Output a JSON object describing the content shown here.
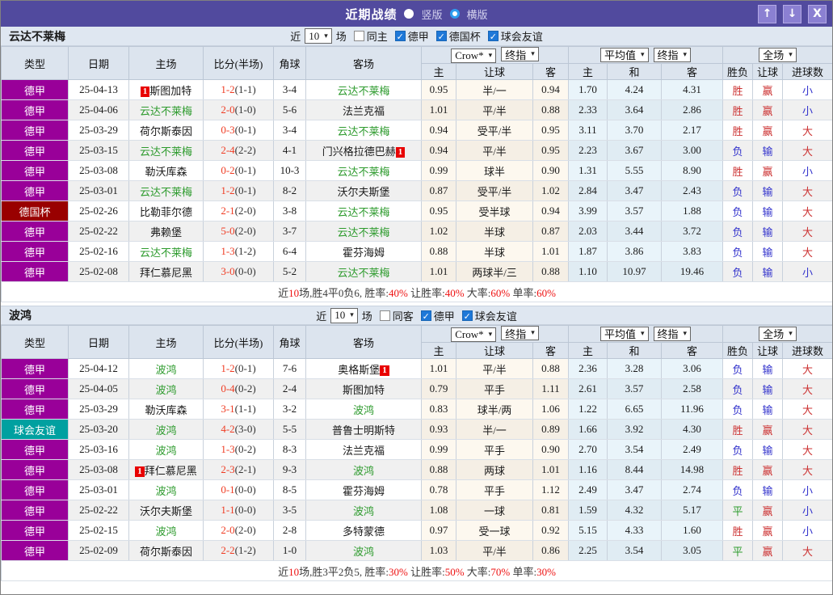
{
  "titlebar": {
    "title": "近期战绩",
    "radio_vertical": "竖版",
    "radio_horizontal": "横版",
    "selected_layout": "横版",
    "button_up": "↑",
    "button_down": "↓",
    "button_close": "X"
  },
  "badge": {
    "text": "1"
  },
  "colors": {
    "titlebar_bg": "#514a9e",
    "type_bg": {
      "德甲": "#990099",
      "德国杯": "#990000",
      "球会友谊": "#00a0a0"
    },
    "focus_team_green": "#2e9b2e",
    "score_red": "#f03c23",
    "result_red": "#cc3333",
    "result_blue": "#3333cc",
    "result_green": "#2e9b2e",
    "summary_red": "#ee1111"
  },
  "result_class_map": {
    "胜": "red",
    "负": "blue",
    "平": "green",
    "赢": "red",
    "输": "blue",
    "大": "red",
    "小": "blue"
  },
  "table": {
    "main_headers": [
      "类型",
      "日期",
      "主场",
      "比分(半场)",
      "角球",
      "客场"
    ],
    "sub_headers": [
      "主",
      "让球",
      "客",
      "主",
      "和",
      "客",
      "胜负",
      "让球",
      "进球数"
    ],
    "selects": {
      "company": "Crow*",
      "company_mode": "终指",
      "avg": "平均值",
      "avg_mode": "终指",
      "scope": "全场"
    }
  },
  "sections": [
    {
      "team": "云达不莱梅",
      "filter": {
        "near_label": "近",
        "count": "10",
        "games_label": "场",
        "same": {
          "label": "同主",
          "checked": false
        },
        "comps": [
          {
            "label": "德甲",
            "checked": true
          },
          {
            "label": "德国杯",
            "checked": true
          },
          {
            "label": "球会友谊",
            "checked": true
          }
        ]
      },
      "rows": [
        {
          "type": "德甲",
          "date": "25-04-13",
          "home": "斯图加特",
          "home_focus": false,
          "home_badge": "before",
          "score": "1-2",
          "half": "(1-1)",
          "corner": "3-4",
          "away": "云达不莱梅",
          "away_focus": true,
          "away_badge": null,
          "odds": [
            "0.95",
            "半/一",
            "0.94"
          ],
          "avg": [
            "1.70",
            "4.24",
            "4.31"
          ],
          "result": [
            "胜",
            "赢",
            "小"
          ]
        },
        {
          "type": "德甲",
          "date": "25-04-06",
          "home": "云达不莱梅",
          "home_focus": true,
          "home_badge": null,
          "score": "2-0",
          "half": "(1-0)",
          "corner": "5-6",
          "away": "法兰克福",
          "away_focus": false,
          "away_badge": null,
          "odds": [
            "1.01",
            "平/半",
            "0.88"
          ],
          "avg": [
            "2.33",
            "3.64",
            "2.86"
          ],
          "result": [
            "胜",
            "赢",
            "小"
          ]
        },
        {
          "type": "德甲",
          "date": "25-03-29",
          "home": "荷尔斯泰因",
          "home_focus": false,
          "home_badge": null,
          "score": "0-3",
          "half": "(0-1)",
          "corner": "3-4",
          "away": "云达不莱梅",
          "away_focus": true,
          "away_badge": null,
          "odds": [
            "0.94",
            "受平/半",
            "0.95"
          ],
          "avg": [
            "3.11",
            "3.70",
            "2.17"
          ],
          "result": [
            "胜",
            "赢",
            "大"
          ]
        },
        {
          "type": "德甲",
          "date": "25-03-15",
          "home": "云达不莱梅",
          "home_focus": true,
          "home_badge": null,
          "score": "2-4",
          "half": "(2-2)",
          "corner": "4-1",
          "away": "门兴格拉德巴赫",
          "away_focus": false,
          "away_badge": "after",
          "odds": [
            "0.94",
            "平/半",
            "0.95"
          ],
          "avg": [
            "2.23",
            "3.67",
            "3.00"
          ],
          "result": [
            "负",
            "输",
            "大"
          ]
        },
        {
          "type": "德甲",
          "date": "25-03-08",
          "home": "勒沃库森",
          "home_focus": false,
          "home_badge": null,
          "score": "0-2",
          "half": "(0-1)",
          "corner": "10-3",
          "away": "云达不莱梅",
          "away_focus": true,
          "away_badge": null,
          "odds": [
            "0.99",
            "球半",
            "0.90"
          ],
          "avg": [
            "1.31",
            "5.55",
            "8.90"
          ],
          "result": [
            "胜",
            "赢",
            "小"
          ]
        },
        {
          "type": "德甲",
          "date": "25-03-01",
          "home": "云达不莱梅",
          "home_focus": true,
          "home_badge": null,
          "score": "1-2",
          "half": "(0-1)",
          "corner": "8-2",
          "away": "沃尔夫斯堡",
          "away_focus": false,
          "away_badge": null,
          "odds": [
            "0.87",
            "受平/半",
            "1.02"
          ],
          "avg": [
            "2.84",
            "3.47",
            "2.43"
          ],
          "result": [
            "负",
            "输",
            "大"
          ]
        },
        {
          "type": "德国杯",
          "date": "25-02-26",
          "home": "比勒菲尔德",
          "home_focus": false,
          "home_badge": null,
          "score": "2-1",
          "half": "(2-0)",
          "corner": "3-8",
          "away": "云达不莱梅",
          "away_focus": true,
          "away_badge": null,
          "odds": [
            "0.95",
            "受半球",
            "0.94"
          ],
          "avg": [
            "3.99",
            "3.57",
            "1.88"
          ],
          "result": [
            "负",
            "输",
            "大"
          ]
        },
        {
          "type": "德甲",
          "date": "25-02-22",
          "home": "弗赖堡",
          "home_focus": false,
          "home_badge": null,
          "score": "5-0",
          "half": "(2-0)",
          "corner": "3-7",
          "away": "云达不莱梅",
          "away_focus": true,
          "away_badge": null,
          "odds": [
            "1.02",
            "半球",
            "0.87"
          ],
          "avg": [
            "2.03",
            "3.44",
            "3.72"
          ],
          "result": [
            "负",
            "输",
            "大"
          ]
        },
        {
          "type": "德甲",
          "date": "25-02-16",
          "home": "云达不莱梅",
          "home_focus": true,
          "home_badge": null,
          "score": "1-3",
          "half": "(1-2)",
          "corner": "6-4",
          "away": "霍芬海姆",
          "away_focus": false,
          "away_badge": null,
          "odds": [
            "0.88",
            "半球",
            "1.01"
          ],
          "avg": [
            "1.87",
            "3.86",
            "3.83"
          ],
          "result": [
            "负",
            "输",
            "大"
          ]
        },
        {
          "type": "德甲",
          "date": "25-02-08",
          "home": "拜仁慕尼黑",
          "home_focus": false,
          "home_badge": null,
          "score": "3-0",
          "half": "(0-0)",
          "corner": "5-2",
          "away": "云达不莱梅",
          "away_focus": true,
          "away_badge": null,
          "odds": [
            "1.01",
            "两球半/三",
            "0.88"
          ],
          "avg": [
            "1.10",
            "10.97",
            "19.46"
          ],
          "result": [
            "负",
            "输",
            "小"
          ]
        }
      ],
      "summary_segments": [
        {
          "t": "近"
        },
        {
          "t": "10",
          "red": true
        },
        {
          "t": "场,胜4平0负6, 胜率:"
        },
        {
          "t": "40%",
          "red": true
        },
        {
          "t": " 让胜率:"
        },
        {
          "t": "40%",
          "red": true
        },
        {
          "t": " 大率:"
        },
        {
          "t": "60%",
          "red": true
        },
        {
          "t": " 单率:"
        },
        {
          "t": "60%",
          "red": true
        }
      ]
    },
    {
      "team": "波鸿",
      "filter": {
        "near_label": "近",
        "count": "10",
        "games_label": "场",
        "same": {
          "label": "同客",
          "checked": false
        },
        "comps": [
          {
            "label": "德甲",
            "checked": true
          },
          {
            "label": "球会友谊",
            "checked": true
          }
        ]
      },
      "rows": [
        {
          "type": "德甲",
          "date": "25-04-12",
          "home": "波鸿",
          "home_focus": true,
          "home_badge": null,
          "score": "1-2",
          "half": "(0-1)",
          "corner": "7-6",
          "away": "奥格斯堡",
          "away_focus": false,
          "away_badge": "after",
          "odds": [
            "1.01",
            "平/半",
            "0.88"
          ],
          "avg": [
            "2.36",
            "3.28",
            "3.06"
          ],
          "result": [
            "负",
            "输",
            "大"
          ]
        },
        {
          "type": "德甲",
          "date": "25-04-05",
          "home": "波鸿",
          "home_focus": true,
          "home_badge": null,
          "score": "0-4",
          "half": "(0-2)",
          "corner": "2-4",
          "away": "斯图加特",
          "away_focus": false,
          "away_badge": null,
          "odds": [
            "0.79",
            "平手",
            "1.11"
          ],
          "avg": [
            "2.61",
            "3.57",
            "2.58"
          ],
          "result": [
            "负",
            "输",
            "大"
          ]
        },
        {
          "type": "德甲",
          "date": "25-03-29",
          "home": "勒沃库森",
          "home_focus": false,
          "home_badge": null,
          "score": "3-1",
          "half": "(1-1)",
          "corner": "3-2",
          "away": "波鸿",
          "away_focus": true,
          "away_badge": null,
          "odds": [
            "0.83",
            "球半/两",
            "1.06"
          ],
          "avg": [
            "1.22",
            "6.65",
            "11.96"
          ],
          "result": [
            "负",
            "输",
            "大"
          ]
        },
        {
          "type": "球会友谊",
          "date": "25-03-20",
          "home": "波鸿",
          "home_focus": true,
          "home_badge": null,
          "score": "4-2",
          "half": "(3-0)",
          "corner": "5-5",
          "away": "普鲁士明斯特",
          "away_focus": false,
          "away_badge": null,
          "odds": [
            "0.93",
            "半/一",
            "0.89"
          ],
          "avg": [
            "1.66",
            "3.92",
            "4.30"
          ],
          "result": [
            "胜",
            "赢",
            "大"
          ]
        },
        {
          "type": "德甲",
          "date": "25-03-16",
          "home": "波鸿",
          "home_focus": true,
          "home_badge": null,
          "score": "1-3",
          "half": "(0-2)",
          "corner": "8-3",
          "away": "法兰克福",
          "away_focus": false,
          "away_badge": null,
          "odds": [
            "0.99",
            "平手",
            "0.90"
          ],
          "avg": [
            "2.70",
            "3.54",
            "2.49"
          ],
          "result": [
            "负",
            "输",
            "大"
          ]
        },
        {
          "type": "德甲",
          "date": "25-03-08",
          "home": "拜仁慕尼黑",
          "home_focus": false,
          "home_badge": "before",
          "score": "2-3",
          "half": "(2-1)",
          "corner": "9-3",
          "away": "波鸿",
          "away_focus": true,
          "away_badge": null,
          "odds": [
            "0.88",
            "两球",
            "1.01"
          ],
          "avg": [
            "1.16",
            "8.44",
            "14.98"
          ],
          "result": [
            "胜",
            "赢",
            "大"
          ]
        },
        {
          "type": "德甲",
          "date": "25-03-01",
          "home": "波鸿",
          "home_focus": true,
          "home_badge": null,
          "score": "0-1",
          "half": "(0-0)",
          "corner": "8-5",
          "away": "霍芬海姆",
          "away_focus": false,
          "away_badge": null,
          "odds": [
            "0.78",
            "平手",
            "1.12"
          ],
          "avg": [
            "2.49",
            "3.47",
            "2.74"
          ],
          "result": [
            "负",
            "输",
            "小"
          ]
        },
        {
          "type": "德甲",
          "date": "25-02-22",
          "home": "沃尔夫斯堡",
          "home_focus": false,
          "home_badge": null,
          "score": "1-1",
          "half": "(0-0)",
          "corner": "3-5",
          "away": "波鸿",
          "away_focus": true,
          "away_badge": null,
          "odds": [
            "1.08",
            "一球",
            "0.81"
          ],
          "avg": [
            "1.59",
            "4.32",
            "5.17"
          ],
          "result": [
            "平",
            "赢",
            "小"
          ]
        },
        {
          "type": "德甲",
          "date": "25-02-15",
          "home": "波鸿",
          "home_focus": true,
          "home_badge": null,
          "score": "2-0",
          "half": "(2-0)",
          "corner": "2-8",
          "away": "多特蒙德",
          "away_focus": false,
          "away_badge": null,
          "odds": [
            "0.97",
            "受一球",
            "0.92"
          ],
          "avg": [
            "5.15",
            "4.33",
            "1.60"
          ],
          "result": [
            "胜",
            "赢",
            "小"
          ]
        },
        {
          "type": "德甲",
          "date": "25-02-09",
          "home": "荷尔斯泰因",
          "home_focus": false,
          "home_badge": null,
          "score": "2-2",
          "half": "(1-2)",
          "corner": "1-0",
          "away": "波鸿",
          "away_focus": true,
          "away_badge": null,
          "odds": [
            "1.03",
            "平/半",
            "0.86"
          ],
          "avg": [
            "2.25",
            "3.54",
            "3.05"
          ],
          "result": [
            "平",
            "赢",
            "大"
          ]
        }
      ],
      "summary_segments": [
        {
          "t": "近"
        },
        {
          "t": "10",
          "red": true
        },
        {
          "t": "场,胜3平2负5, 胜率:"
        },
        {
          "t": "30%",
          "red": true
        },
        {
          "t": " 让胜率:"
        },
        {
          "t": "50%",
          "red": true
        },
        {
          "t": " 大率:"
        },
        {
          "t": "70%",
          "red": true
        },
        {
          "t": " 单率:"
        },
        {
          "t": "30%",
          "red": true
        }
      ]
    }
  ]
}
